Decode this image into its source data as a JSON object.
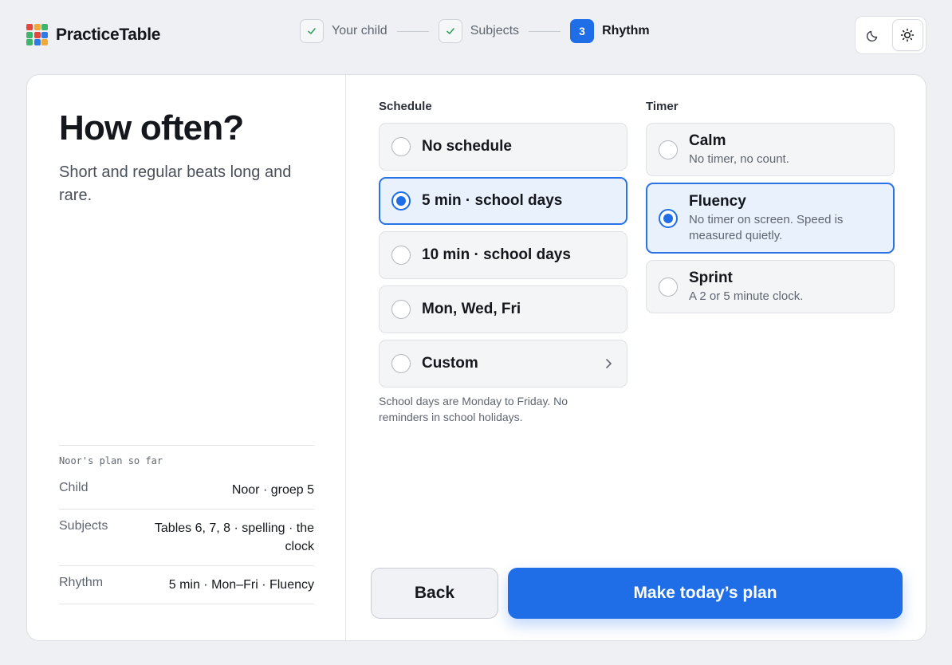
{
  "brand": {
    "name": "PracticeTable",
    "logo_colors": [
      "#e2483d",
      "#f2a93b",
      "#3fb46c",
      "#3fb46c",
      "#e2483d",
      "#2d7be5",
      "#3fb46c",
      "#2d7be5",
      "#f2a93b"
    ]
  },
  "stepper": {
    "steps": [
      {
        "label": "Your child",
        "status": "done",
        "badge": ""
      },
      {
        "label": "Subjects",
        "status": "done",
        "badge": ""
      },
      {
        "label": "Rhythm",
        "status": "active",
        "badge": "3"
      }
    ]
  },
  "theme": {
    "options": [
      "moon-icon",
      "sun-icon"
    ],
    "selected": "light"
  },
  "left": {
    "title": "How often?",
    "subtitle": "Short and regular beats long and rare.",
    "summary": {
      "heading": "Noor's plan so far",
      "rows": [
        {
          "key": "Child",
          "value": "Noor · groep 5"
        },
        {
          "key": "Subjects",
          "value": "Tables 6, 7, 8 · spelling · the clock"
        },
        {
          "key": "Rhythm",
          "value": "5 min · Mon–Fri · Fluency"
        }
      ]
    }
  },
  "schedule": {
    "label": "Schedule",
    "options": [
      {
        "label": "No schedule",
        "selected": false
      },
      {
        "label": "5 min · school days",
        "selected": true
      },
      {
        "label": "10 min · school days",
        "selected": false
      },
      {
        "label": "Mon, Wed, Fri",
        "selected": false
      },
      {
        "label": "Custom",
        "selected": false
      }
    ],
    "note": "School days are Monday to Friday. No reminders in school holidays."
  },
  "timer": {
    "label": "Timer",
    "options": [
      {
        "label": "Calm",
        "desc": "No timer, no count.",
        "selected": false
      },
      {
        "label": "Fluency",
        "desc": "No timer on screen. Speed is measured quietly.",
        "selected": true
      },
      {
        "label": "Sprint",
        "desc": "A 2 or 5 minute clock.",
        "selected": false
      }
    ]
  },
  "actions": {
    "back": "Back",
    "primary": "Make today’s plan"
  },
  "colors": {
    "accent": "#1f6ee8",
    "selected_bg": "#e9f1fd"
  }
}
